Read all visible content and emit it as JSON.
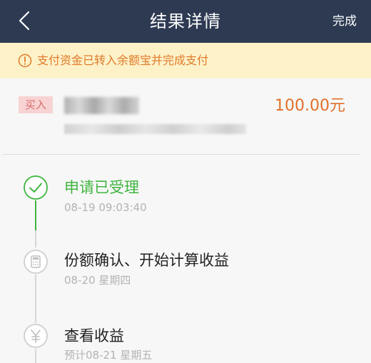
{
  "header": {
    "title": "结果详情",
    "done_label": "完成",
    "background": "#2d3a52"
  },
  "notice": {
    "text": "支付资金已转入余额宝并完成支付",
    "icon": "info-circle-icon",
    "color": "#e07c2a",
    "background": "#fdf1c8"
  },
  "order": {
    "tag": "买入",
    "fund_name_obscured": true,
    "amount": "100.00元",
    "amount_color": "#e0702a"
  },
  "timeline": {
    "steps": [
      {
        "title": "申请已受理",
        "time": "08-19 09:03:40",
        "status": "done",
        "icon": "check-icon"
      },
      {
        "title": "份额确认、开始计算收益",
        "time": "08-20 星期四",
        "status": "pending",
        "icon": "calculator-icon"
      },
      {
        "title": "查看收益",
        "time": "预计08-21 星期五",
        "status": "pending",
        "icon": "yuan-icon"
      }
    ],
    "done_color": "#3fb53f",
    "pending_color": "#cfcfcf"
  }
}
